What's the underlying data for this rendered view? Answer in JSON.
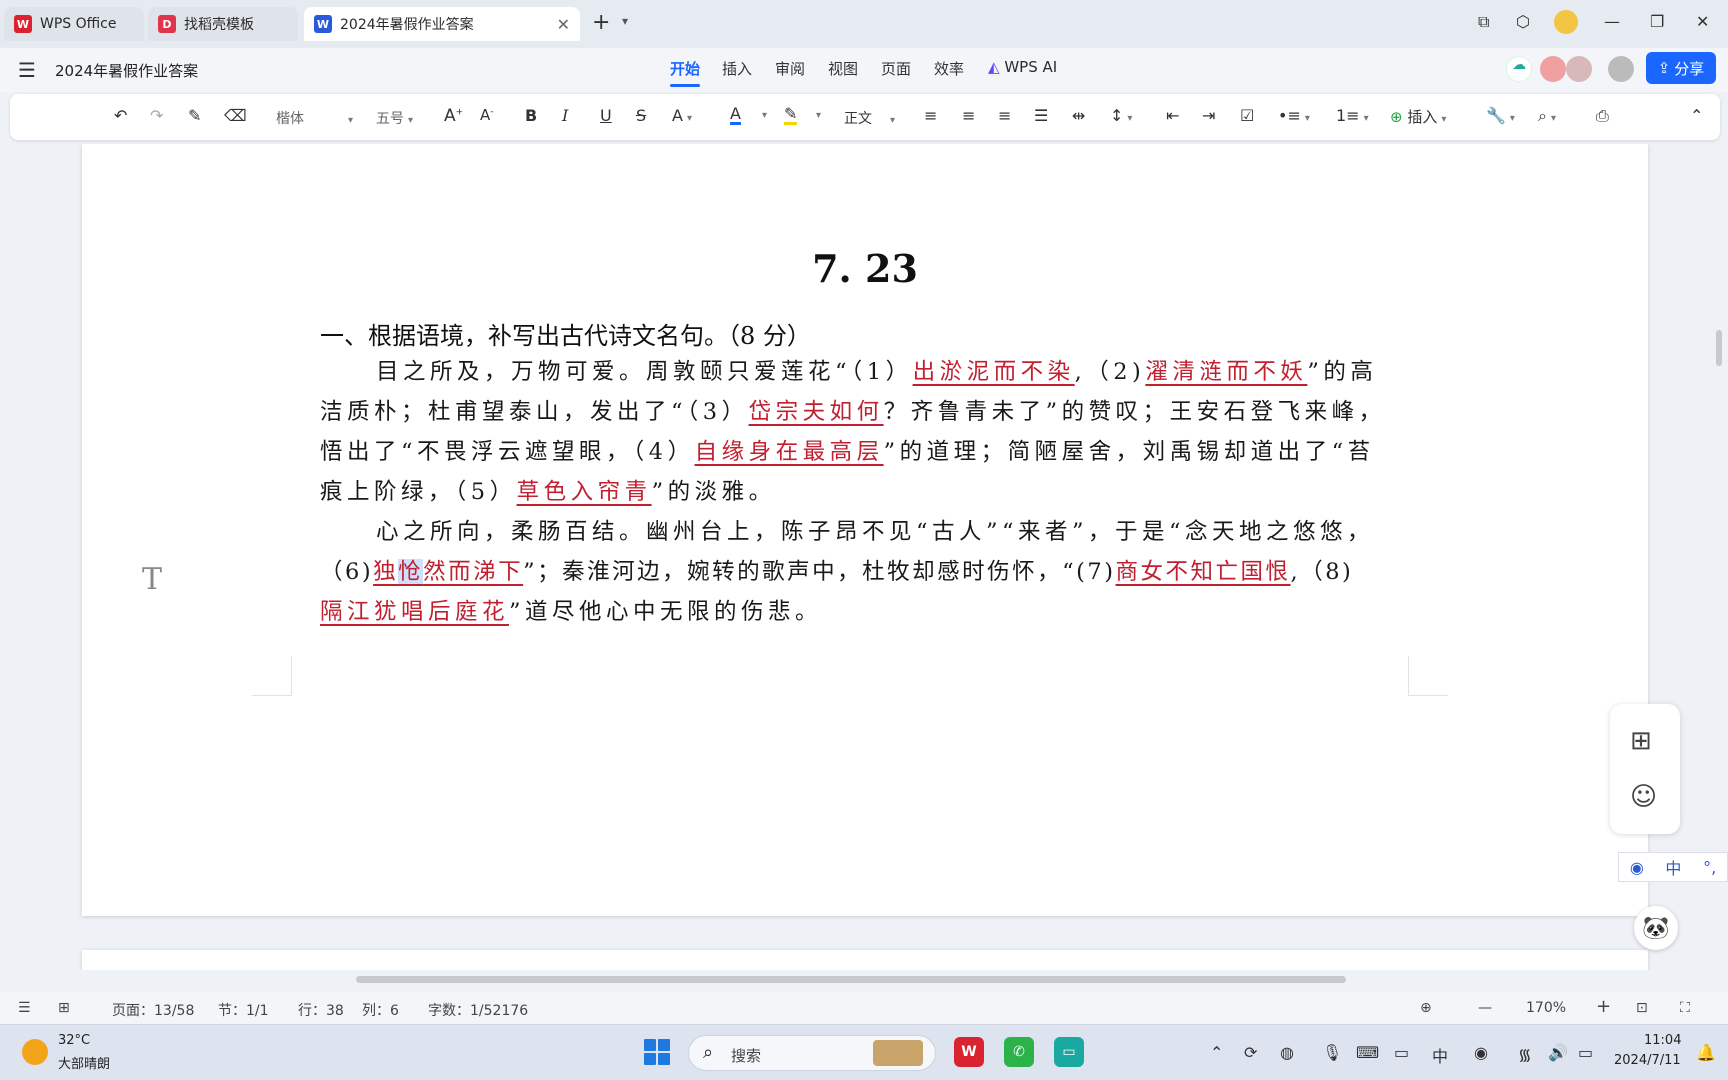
{
  "tabs": [
    {
      "label": "WPS Office",
      "icon": "wps-logo-icon",
      "color": "#d9232e"
    },
    {
      "label": "找稻壳模板",
      "icon": "docer-icon",
      "color": "#e0354a"
    },
    {
      "label": "2024年暑假作业答案",
      "icon": "word-doc-icon",
      "color": "#2a5bd7"
    }
  ],
  "menubar": {
    "doc_title": "2024年暑假作业答案",
    "items": [
      "开始",
      "插入",
      "审阅",
      "视图",
      "页面",
      "效率",
      "WPS AI"
    ],
    "active": "开始",
    "share_label": "分享"
  },
  "toolbar": {
    "font_name": "楷体",
    "font_size": "五号",
    "style": "正文",
    "insert_label": "插入"
  },
  "document": {
    "heading": "7. 23",
    "section_title": "一、根据语境，补写出古代诗文名句。（8 分）",
    "p1": {
      "l1_a": "目之所及，万物可爱。周敦颐只爱莲花“（1）",
      "ans1": "出淤泥而不染",
      "l1_b": ",（2)",
      "ans2": "濯清涟而不妖",
      "l1_c": "”的高",
      "l2_a": "洁质朴；杜甫望泰山，发出了“（3）",
      "ans3": "岱宗夫如何",
      "l2_b": "？齐鲁青未了”的赞叹；王安石登飞来峰，",
      "l3_a": "悟出了“不畏浮云遮望眼，（4）",
      "ans4": "自缘身在最高层",
      "l3_b": "”的道理；简陋屋舍，刘禹锡却道出了“苔",
      "l4_a": "痕上阶绿，（5）",
      "ans5": "草色入帘青",
      "l4_b": "”的淡雅。"
    },
    "p2": {
      "l1": "心之所向，柔肠百结。幽州台上，陈子昂不见“古人”“来者”，于是“念天地之悠悠，",
      "l2_a": "（6)",
      "ans6_a": "独",
      "ans6_sel": "怆",
      "ans6_b": "然而涕下",
      "l2_b": "”；秦淮河边，婉转的歌声中，杜牧却感时伤怀，“(7)",
      "ans7": "商女不知亡国恨",
      "l2_c": ",（8)",
      "ans8": "隔江犹唱后庭花",
      "l3_b": "”道尽他心中无限的伤悲。"
    }
  },
  "statusbar": {
    "page": "页面：13/58",
    "section": "节：1/1",
    "row": "行：38",
    "col": "列：6",
    "words": "字数：1/52176",
    "zoom": "170%"
  },
  "taskbar": {
    "temperature": "32°C",
    "weather": "大部晴朗",
    "search_placeholder": "搜索",
    "time": "11:04",
    "date": "2024/7/11"
  },
  "colors": {
    "accent": "#1a66ff",
    "answer_red": "#c0202f",
    "selection": "#cfe0ff"
  }
}
